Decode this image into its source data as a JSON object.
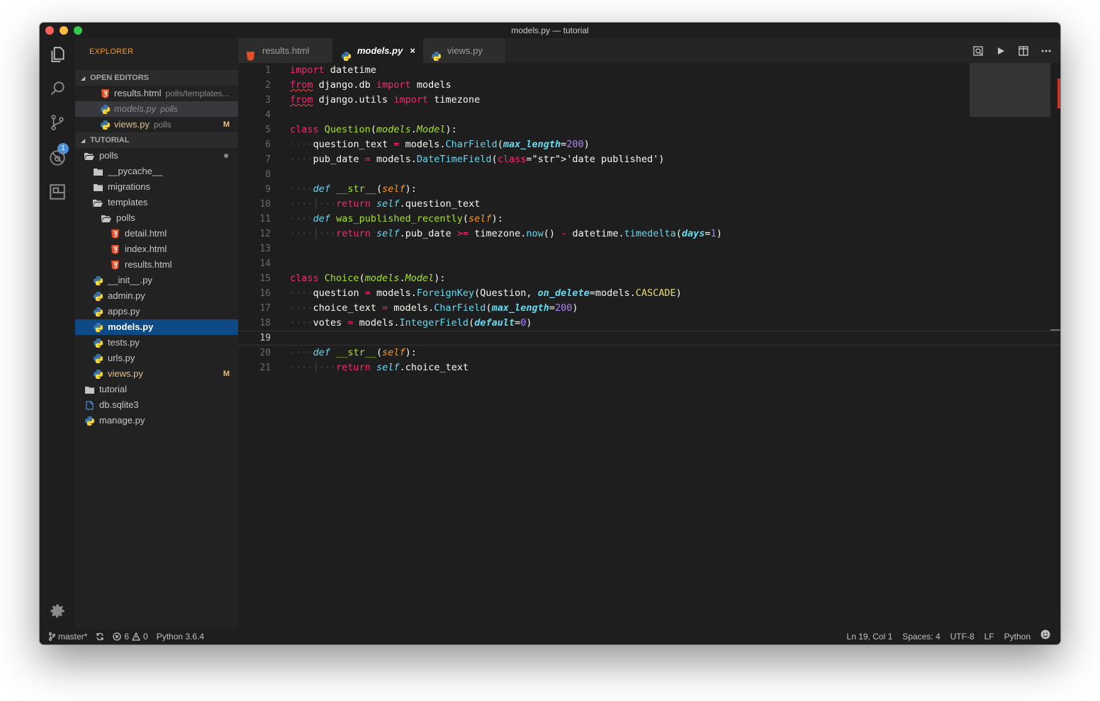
{
  "window": {
    "title": "models.py — tutorial"
  },
  "activity": {
    "scm_badge": "1"
  },
  "sidebar": {
    "title": "EXPLORER",
    "open_editors_header": "OPEN EDITORS",
    "open_editors": [
      {
        "name": "results.html",
        "desc": "polls/templates...",
        "type": "html"
      },
      {
        "name": "models.py",
        "desc": "polls",
        "type": "python"
      },
      {
        "name": "views.py",
        "desc": "polls",
        "type": "python",
        "mark": "M"
      }
    ],
    "tutorial_header": "TUTORIAL",
    "tree": [
      {
        "name": "polls",
        "type": "folder-open",
        "level": 0
      },
      {
        "name": "__pycache__",
        "type": "folder",
        "level": 1
      },
      {
        "name": "migrations",
        "type": "folder",
        "level": 1
      },
      {
        "name": "templates",
        "type": "folder-open",
        "level": 1
      },
      {
        "name": "polls",
        "type": "folder-open",
        "level": 2
      },
      {
        "name": "detail.html",
        "type": "html",
        "level": 3
      },
      {
        "name": "index.html",
        "type": "html",
        "level": 3
      },
      {
        "name": "results.html",
        "type": "html",
        "level": 3
      },
      {
        "name": "__init__.py",
        "type": "python",
        "level": 1
      },
      {
        "name": "admin.py",
        "type": "python",
        "level": 1
      },
      {
        "name": "apps.py",
        "type": "python",
        "level": 1
      },
      {
        "name": "models.py",
        "type": "python",
        "level": 1
      },
      {
        "name": "tests.py",
        "type": "python",
        "level": 1
      },
      {
        "name": "urls.py",
        "type": "python",
        "level": 1
      },
      {
        "name": "views.py",
        "type": "python",
        "level": 1,
        "mark": "M"
      },
      {
        "name": "tutorial",
        "type": "folder",
        "level": 0
      },
      {
        "name": "db.sqlite3",
        "type": "file",
        "level": 0
      },
      {
        "name": "manage.py",
        "type": "python",
        "level": 0
      }
    ]
  },
  "tabs": [
    {
      "label": "results.html",
      "type": "html"
    },
    {
      "label": "models.py",
      "type": "python",
      "close": "×"
    },
    {
      "label": "views.py",
      "type": "python"
    }
  ],
  "editor": {
    "line_numbers": [
      "1",
      "2",
      "3",
      "4",
      "5",
      "6",
      "7",
      "8",
      "9",
      "10",
      "11",
      "12",
      "13",
      "14",
      "15",
      "16",
      "17",
      "18",
      "19",
      "20",
      "21"
    ],
    "lines": [
      "import datetime",
      "from django.db import models",
      "from django.utils import timezone",
      "",
      "class Question(models.Model):",
      "    question_text = models.CharField(max_length=200)",
      "    pub_date = models.DateTimeField('date published')",
      "",
      "    def __str__(self):",
      "        return self.question_text",
      "    def was_published_recently(self):",
      "        return self.pub_date >= timezone.now() - datetime.timedelta(days=1)",
      "",
      "",
      "class Choice(models.Model):",
      "    question = models.ForeignKey(Question, on_delete=models.CASCADE)",
      "    choice_text = models.CharField(max_length=200)",
      "    votes = models.IntegerField(default=0)",
      "",
      "    def __str__(self):",
      "        return self.choice_text"
    ],
    "current_line": "19"
  },
  "status": {
    "branch": "master*",
    "errors": "6",
    "warnings": "0",
    "interpreter": "Python 3.6.4",
    "position": "Ln 19, Col 1",
    "spaces": "Spaces: 4",
    "encoding": "UTF-8",
    "eol": "LF",
    "language": "Python"
  },
  "colors": {
    "accent": "#fd971f",
    "keyword": "#f92672",
    "string": "#e6db74",
    "number": "#ae81ff",
    "function": "#a6e22e",
    "builtin": "#66d9ef",
    "selection": "#0f4a85"
  }
}
